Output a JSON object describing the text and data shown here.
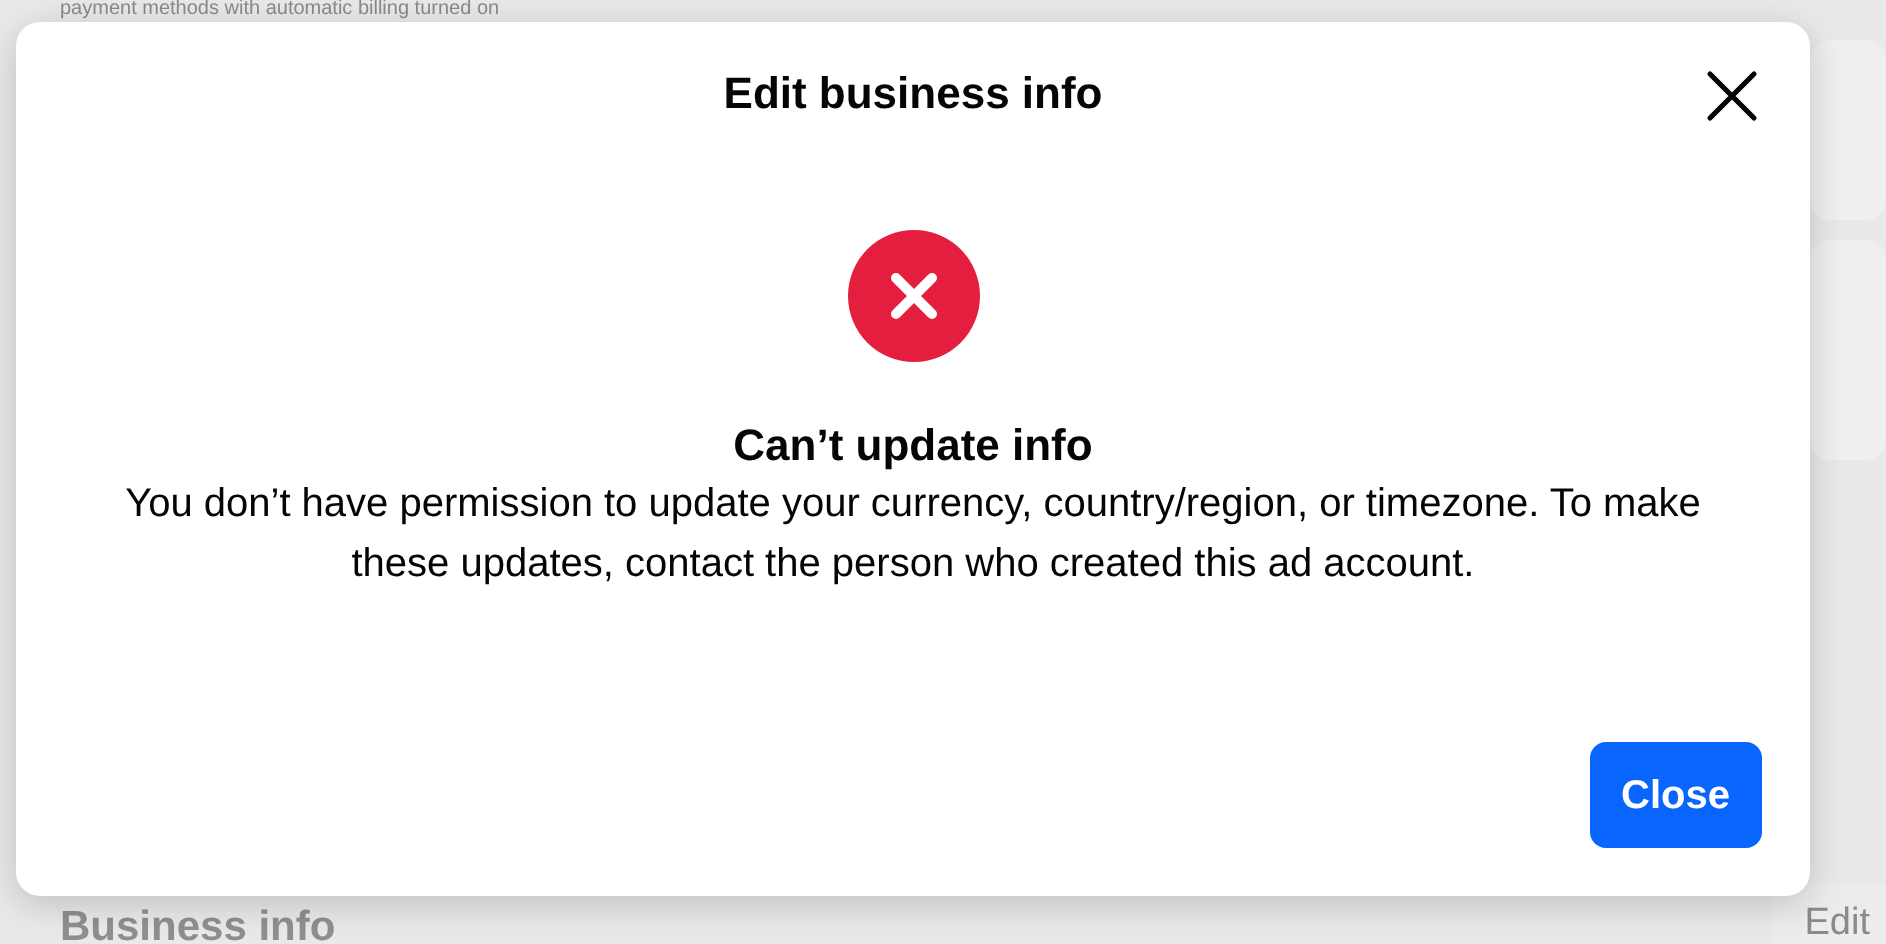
{
  "background": {
    "notice": "payment methods with automatic billing turned on",
    "section_title": "Business info",
    "edit_link": "Edit"
  },
  "dialog": {
    "title": "Edit business info",
    "error": {
      "heading": "Can’t update info",
      "message": "You don’t have permission to update your currency, country/region, or timezone. To make these updates, contact the person who created this ad account."
    },
    "buttons": [
      {
        "label": "Close",
        "kind": "primary"
      }
    ]
  }
}
